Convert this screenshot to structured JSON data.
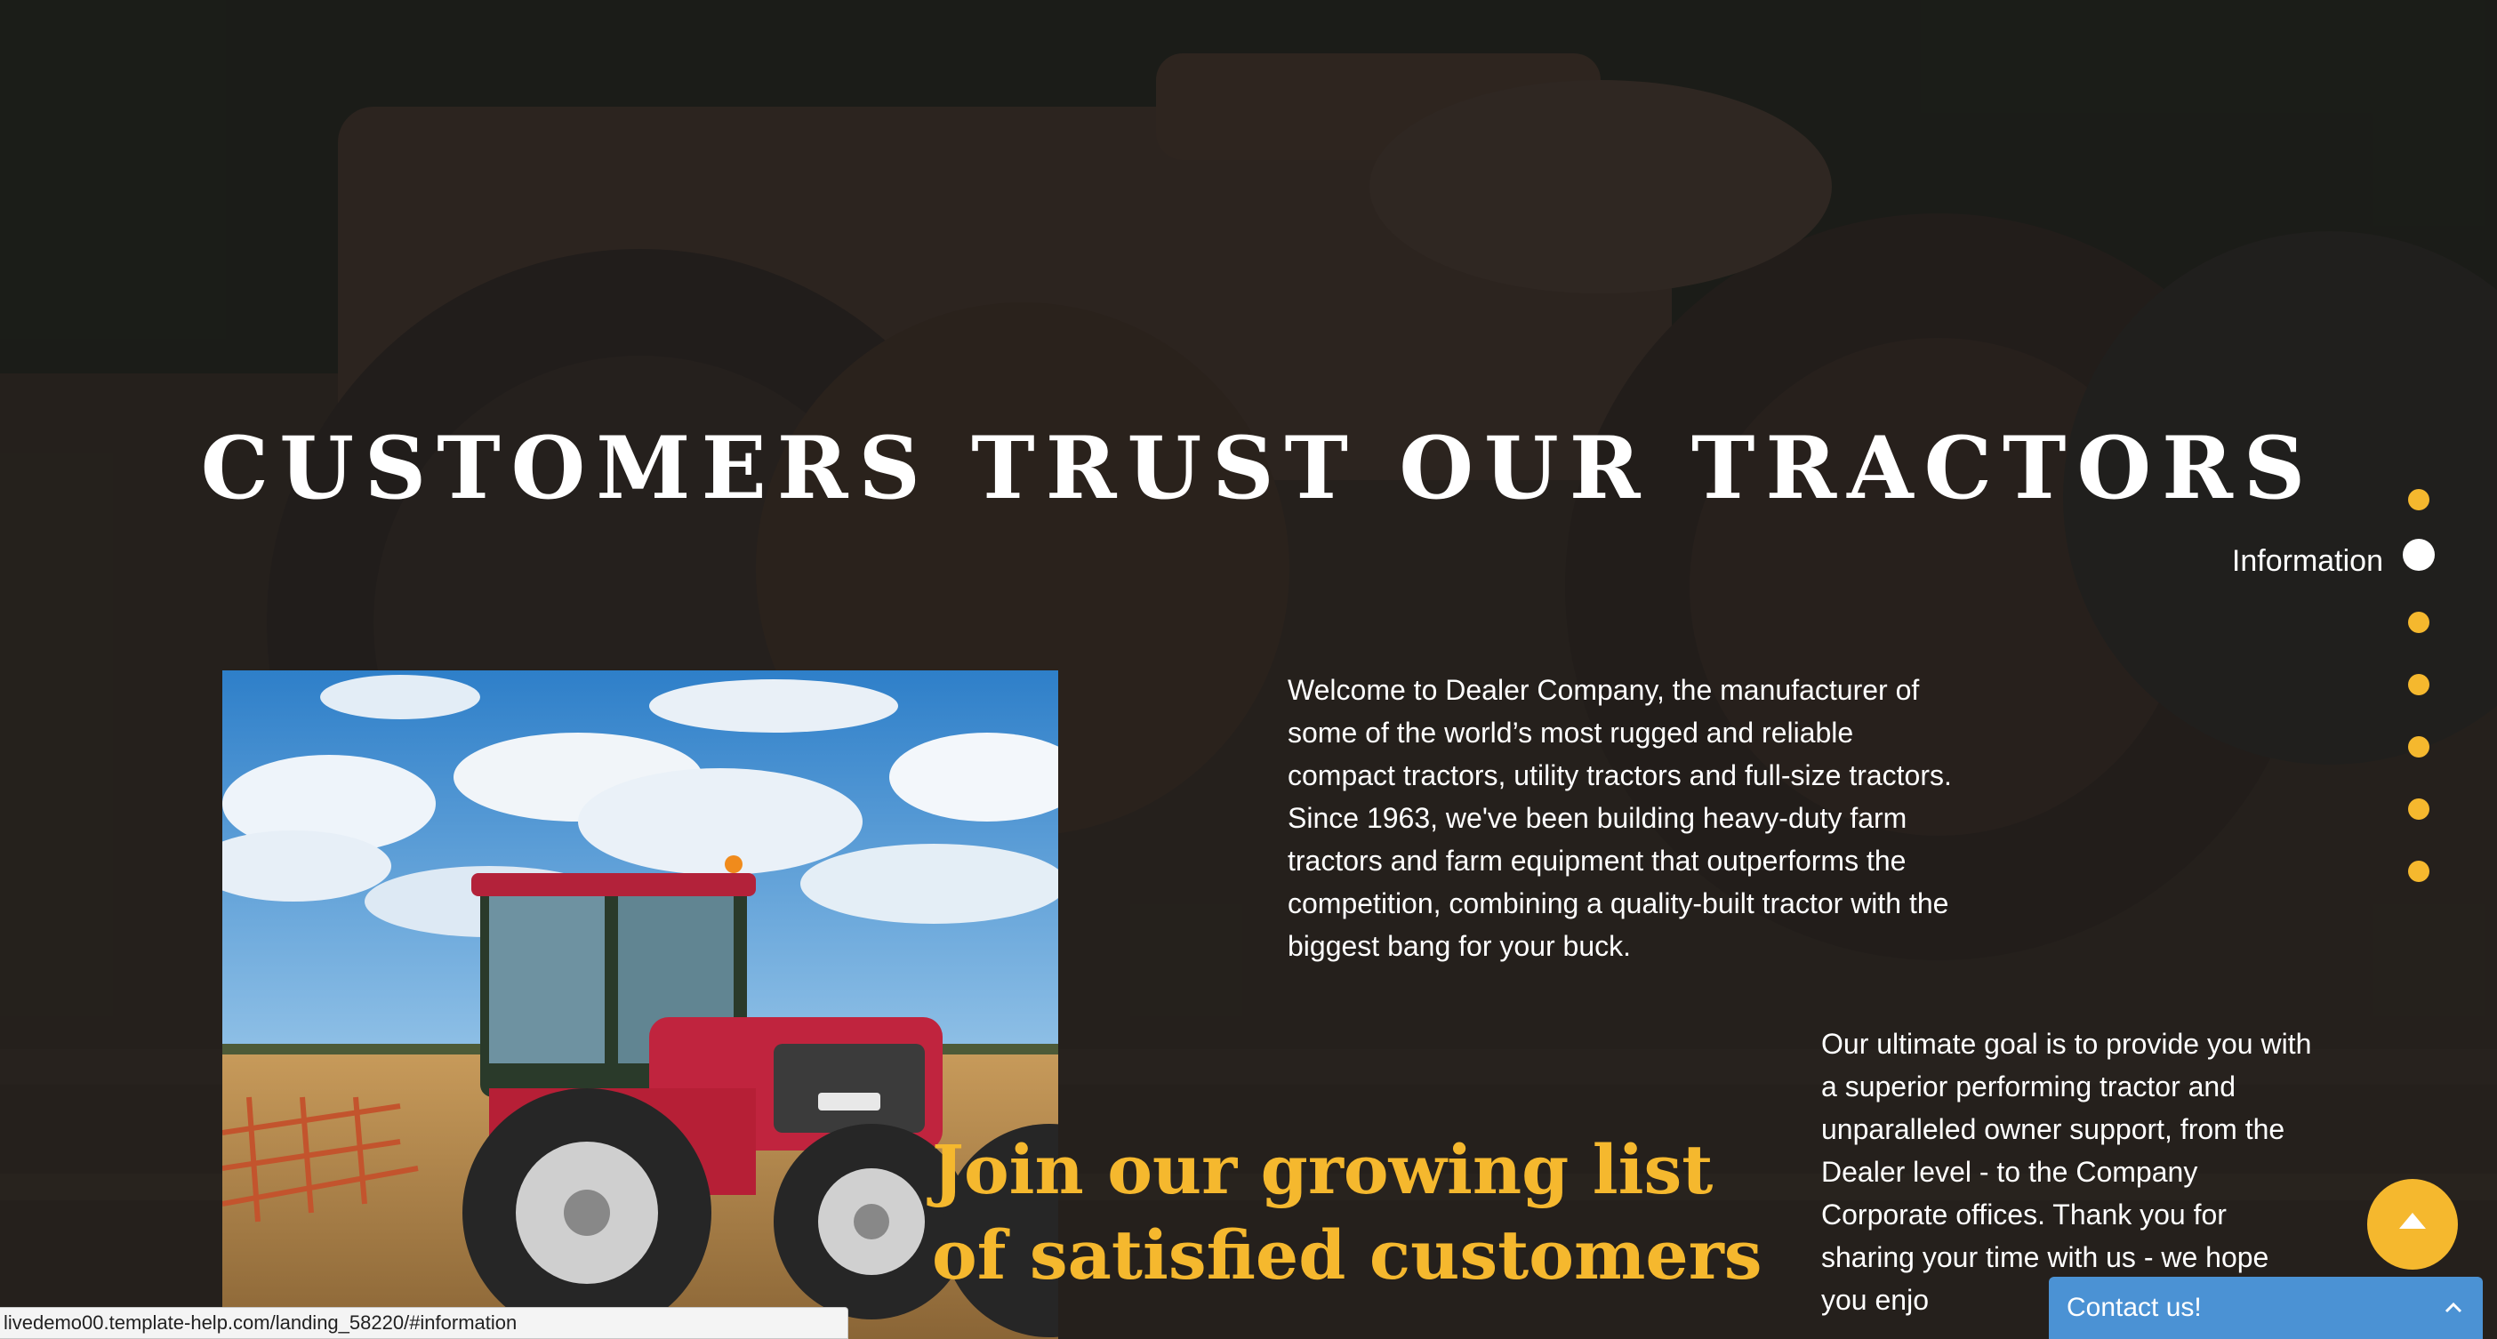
{
  "hero": {
    "title": "CUSTOMERS TRUST OUR TRACTORS"
  },
  "intro": {
    "paragraph": "Welcome to Dealer Company, the manufacturer of some of the world’s most rugged and reliable compact tractors, utility tractors and full-size tractors. Since 1963, we've been building heavy-duty farm tractors and farm equipment that outperforms the competition, combining a quality-built tractor with the biggest bang for your buck."
  },
  "goal": {
    "paragraph": "Our ultimate goal is to provide you with a superior performing tractor and unparalleled owner support, from the Dealer level - to the Company Corporate offices. Thank you for sharing your time with us - we hope you enjo"
  },
  "join": {
    "line1": "Join our growing list",
    "line2": "of satisfied customers"
  },
  "dot_nav": {
    "active_label": "Information",
    "count": 7,
    "active_index": 1
  },
  "contact": {
    "label": "Contact us!"
  },
  "status_bar": {
    "url": "livedemo00.template-help.com/landing_58220/#information"
  },
  "colors": {
    "accent": "#f5b82e",
    "contact_blue": "#4b92d4",
    "background": "#1f1d1b"
  }
}
